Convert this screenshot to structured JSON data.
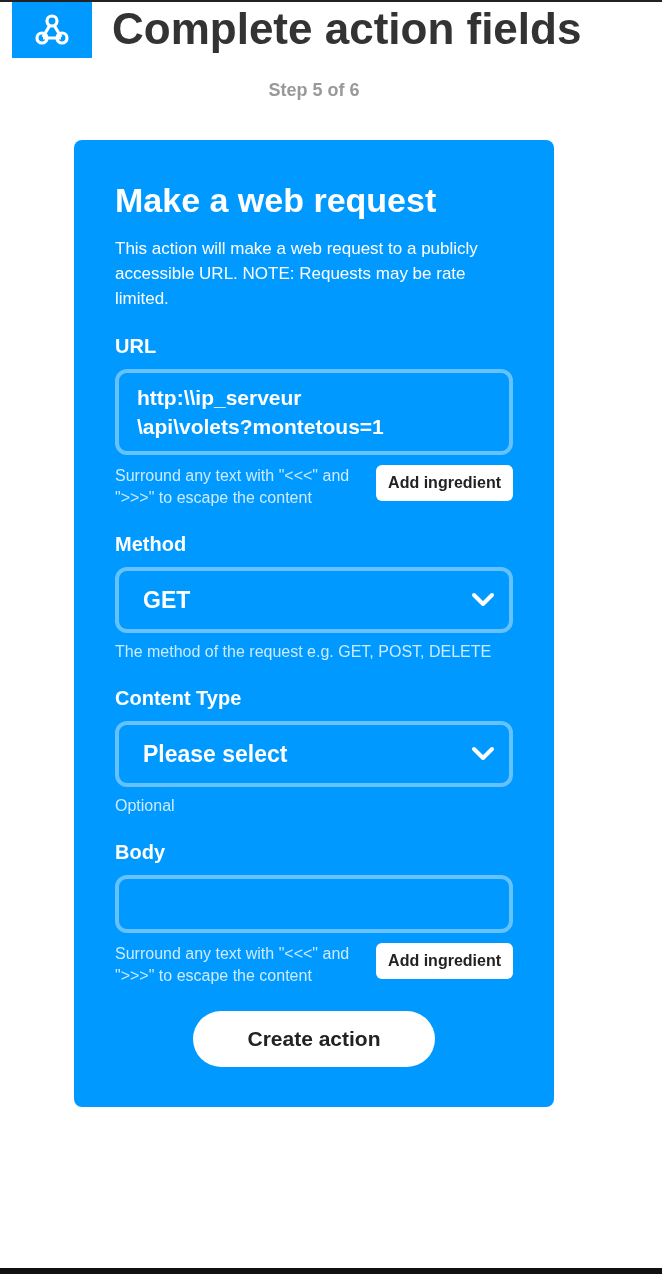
{
  "header": {
    "title": "Complete action fields",
    "step": "Step 5 of 6"
  },
  "card": {
    "title": "Make a web request",
    "description": "This action will make a web request to a publicly accessible URL. NOTE: Requests may be rate limited.",
    "fields": [
      {
        "kind": "text",
        "label": "URL",
        "value_lines": [
          "http:\\\\ip_serveur",
          "\\api\\volets?montetous=1"
        ],
        "hint": "Surround any text with \"<<<\" and \">>>\" to escape the content",
        "button": "Add ingredient"
      },
      {
        "kind": "select",
        "label": "Method",
        "value": "GET",
        "hint": "The method of the request e.g. GET, POST, DELETE"
      },
      {
        "kind": "select",
        "label": "Content Type",
        "value": "Please select",
        "hint": "Optional"
      },
      {
        "kind": "text",
        "label": "Body",
        "hint": "Surround any text with \"<<<\" and \">>>\" to escape the content",
        "button": "Add ingredient"
      }
    ],
    "submit": "Create action"
  }
}
